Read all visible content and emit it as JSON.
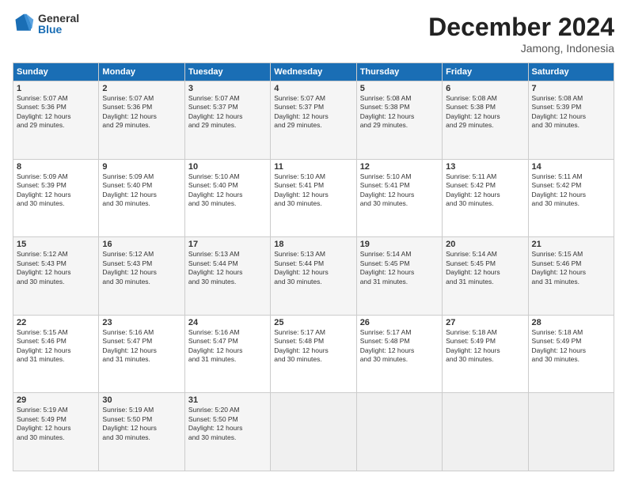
{
  "logo": {
    "general": "General",
    "blue": "Blue"
  },
  "header": {
    "title": "December 2024",
    "location": "Jamong, Indonesia"
  },
  "weekdays": [
    "Sunday",
    "Monday",
    "Tuesday",
    "Wednesday",
    "Thursday",
    "Friday",
    "Saturday"
  ],
  "weeks": [
    [
      {
        "day": "1",
        "sunrise": "5:07 AM",
        "sunset": "5:36 PM",
        "daylight": "12 hours and 29 minutes."
      },
      {
        "day": "2",
        "sunrise": "5:07 AM",
        "sunset": "5:36 PM",
        "daylight": "12 hours and 29 minutes."
      },
      {
        "day": "3",
        "sunrise": "5:07 AM",
        "sunset": "5:37 PM",
        "daylight": "12 hours and 29 minutes."
      },
      {
        "day": "4",
        "sunrise": "5:07 AM",
        "sunset": "5:37 PM",
        "daylight": "12 hours and 29 minutes."
      },
      {
        "day": "5",
        "sunrise": "5:08 AM",
        "sunset": "5:38 PM",
        "daylight": "12 hours and 29 minutes."
      },
      {
        "day": "6",
        "sunrise": "5:08 AM",
        "sunset": "5:38 PM",
        "daylight": "12 hours and 29 minutes."
      },
      {
        "day": "7",
        "sunrise": "5:08 AM",
        "sunset": "5:39 PM",
        "daylight": "12 hours and 30 minutes."
      }
    ],
    [
      {
        "day": "8",
        "sunrise": "5:09 AM",
        "sunset": "5:39 PM",
        "daylight": "12 hours and 30 minutes."
      },
      {
        "day": "9",
        "sunrise": "5:09 AM",
        "sunset": "5:40 PM",
        "daylight": "12 hours and 30 minutes."
      },
      {
        "day": "10",
        "sunrise": "5:10 AM",
        "sunset": "5:40 PM",
        "daylight": "12 hours and 30 minutes."
      },
      {
        "day": "11",
        "sunrise": "5:10 AM",
        "sunset": "5:41 PM",
        "daylight": "12 hours and 30 minutes."
      },
      {
        "day": "12",
        "sunrise": "5:10 AM",
        "sunset": "5:41 PM",
        "daylight": "12 hours and 30 minutes."
      },
      {
        "day": "13",
        "sunrise": "5:11 AM",
        "sunset": "5:42 PM",
        "daylight": "12 hours and 30 minutes."
      },
      {
        "day": "14",
        "sunrise": "5:11 AM",
        "sunset": "5:42 PM",
        "daylight": "12 hours and 30 minutes."
      }
    ],
    [
      {
        "day": "15",
        "sunrise": "5:12 AM",
        "sunset": "5:43 PM",
        "daylight": "12 hours and 30 minutes."
      },
      {
        "day": "16",
        "sunrise": "5:12 AM",
        "sunset": "5:43 PM",
        "daylight": "12 hours and 30 minutes."
      },
      {
        "day": "17",
        "sunrise": "5:13 AM",
        "sunset": "5:44 PM",
        "daylight": "12 hours and 30 minutes."
      },
      {
        "day": "18",
        "sunrise": "5:13 AM",
        "sunset": "5:44 PM",
        "daylight": "12 hours and 30 minutes."
      },
      {
        "day": "19",
        "sunrise": "5:14 AM",
        "sunset": "5:45 PM",
        "daylight": "12 hours and 31 minutes."
      },
      {
        "day": "20",
        "sunrise": "5:14 AM",
        "sunset": "5:45 PM",
        "daylight": "12 hours and 31 minutes."
      },
      {
        "day": "21",
        "sunrise": "5:15 AM",
        "sunset": "5:46 PM",
        "daylight": "12 hours and 31 minutes."
      }
    ],
    [
      {
        "day": "22",
        "sunrise": "5:15 AM",
        "sunset": "5:46 PM",
        "daylight": "12 hours and 31 minutes."
      },
      {
        "day": "23",
        "sunrise": "5:16 AM",
        "sunset": "5:47 PM",
        "daylight": "12 hours and 31 minutes."
      },
      {
        "day": "24",
        "sunrise": "5:16 AM",
        "sunset": "5:47 PM",
        "daylight": "12 hours and 31 minutes."
      },
      {
        "day": "25",
        "sunrise": "5:17 AM",
        "sunset": "5:48 PM",
        "daylight": "12 hours and 30 minutes."
      },
      {
        "day": "26",
        "sunrise": "5:17 AM",
        "sunset": "5:48 PM",
        "daylight": "12 hours and 30 minutes."
      },
      {
        "day": "27",
        "sunrise": "5:18 AM",
        "sunset": "5:49 PM",
        "daylight": "12 hours and 30 minutes."
      },
      {
        "day": "28",
        "sunrise": "5:18 AM",
        "sunset": "5:49 PM",
        "daylight": "12 hours and 30 minutes."
      }
    ],
    [
      {
        "day": "29",
        "sunrise": "5:19 AM",
        "sunset": "5:49 PM",
        "daylight": "12 hours and 30 minutes."
      },
      {
        "day": "30",
        "sunrise": "5:19 AM",
        "sunset": "5:50 PM",
        "daylight": "12 hours and 30 minutes."
      },
      {
        "day": "31",
        "sunrise": "5:20 AM",
        "sunset": "5:50 PM",
        "daylight": "12 hours and 30 minutes."
      },
      null,
      null,
      null,
      null
    ]
  ],
  "labels": {
    "sunrise": "Sunrise: ",
    "sunset": "Sunset: ",
    "daylight": "Daylight: "
  }
}
